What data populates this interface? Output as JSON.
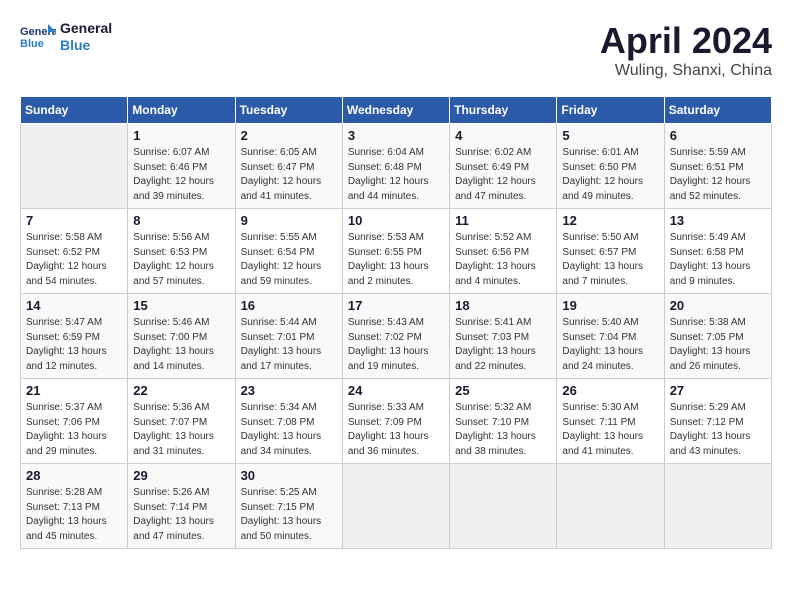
{
  "logo": {
    "line1": "General",
    "line2": "Blue"
  },
  "title": "April 2024",
  "location": "Wuling, Shanxi, China",
  "weekdays": [
    "Sunday",
    "Monday",
    "Tuesday",
    "Wednesday",
    "Thursday",
    "Friday",
    "Saturday"
  ],
  "weeks": [
    [
      {
        "day": "",
        "info": ""
      },
      {
        "day": "1",
        "info": "Sunrise: 6:07 AM\nSunset: 6:46 PM\nDaylight: 12 hours\nand 39 minutes."
      },
      {
        "day": "2",
        "info": "Sunrise: 6:05 AM\nSunset: 6:47 PM\nDaylight: 12 hours\nand 41 minutes."
      },
      {
        "day": "3",
        "info": "Sunrise: 6:04 AM\nSunset: 6:48 PM\nDaylight: 12 hours\nand 44 minutes."
      },
      {
        "day": "4",
        "info": "Sunrise: 6:02 AM\nSunset: 6:49 PM\nDaylight: 12 hours\nand 47 minutes."
      },
      {
        "day": "5",
        "info": "Sunrise: 6:01 AM\nSunset: 6:50 PM\nDaylight: 12 hours\nand 49 minutes."
      },
      {
        "day": "6",
        "info": "Sunrise: 5:59 AM\nSunset: 6:51 PM\nDaylight: 12 hours\nand 52 minutes."
      }
    ],
    [
      {
        "day": "7",
        "info": "Sunrise: 5:58 AM\nSunset: 6:52 PM\nDaylight: 12 hours\nand 54 minutes."
      },
      {
        "day": "8",
        "info": "Sunrise: 5:56 AM\nSunset: 6:53 PM\nDaylight: 12 hours\nand 57 minutes."
      },
      {
        "day": "9",
        "info": "Sunrise: 5:55 AM\nSunset: 6:54 PM\nDaylight: 12 hours\nand 59 minutes."
      },
      {
        "day": "10",
        "info": "Sunrise: 5:53 AM\nSunset: 6:55 PM\nDaylight: 13 hours\nand 2 minutes."
      },
      {
        "day": "11",
        "info": "Sunrise: 5:52 AM\nSunset: 6:56 PM\nDaylight: 13 hours\nand 4 minutes."
      },
      {
        "day": "12",
        "info": "Sunrise: 5:50 AM\nSunset: 6:57 PM\nDaylight: 13 hours\nand 7 minutes."
      },
      {
        "day": "13",
        "info": "Sunrise: 5:49 AM\nSunset: 6:58 PM\nDaylight: 13 hours\nand 9 minutes."
      }
    ],
    [
      {
        "day": "14",
        "info": "Sunrise: 5:47 AM\nSunset: 6:59 PM\nDaylight: 13 hours\nand 12 minutes."
      },
      {
        "day": "15",
        "info": "Sunrise: 5:46 AM\nSunset: 7:00 PM\nDaylight: 13 hours\nand 14 minutes."
      },
      {
        "day": "16",
        "info": "Sunrise: 5:44 AM\nSunset: 7:01 PM\nDaylight: 13 hours\nand 17 minutes."
      },
      {
        "day": "17",
        "info": "Sunrise: 5:43 AM\nSunset: 7:02 PM\nDaylight: 13 hours\nand 19 minutes."
      },
      {
        "day": "18",
        "info": "Sunrise: 5:41 AM\nSunset: 7:03 PM\nDaylight: 13 hours\nand 22 minutes."
      },
      {
        "day": "19",
        "info": "Sunrise: 5:40 AM\nSunset: 7:04 PM\nDaylight: 13 hours\nand 24 minutes."
      },
      {
        "day": "20",
        "info": "Sunrise: 5:38 AM\nSunset: 7:05 PM\nDaylight: 13 hours\nand 26 minutes."
      }
    ],
    [
      {
        "day": "21",
        "info": "Sunrise: 5:37 AM\nSunset: 7:06 PM\nDaylight: 13 hours\nand 29 minutes."
      },
      {
        "day": "22",
        "info": "Sunrise: 5:36 AM\nSunset: 7:07 PM\nDaylight: 13 hours\nand 31 minutes."
      },
      {
        "day": "23",
        "info": "Sunrise: 5:34 AM\nSunset: 7:08 PM\nDaylight: 13 hours\nand 34 minutes."
      },
      {
        "day": "24",
        "info": "Sunrise: 5:33 AM\nSunset: 7:09 PM\nDaylight: 13 hours\nand 36 minutes."
      },
      {
        "day": "25",
        "info": "Sunrise: 5:32 AM\nSunset: 7:10 PM\nDaylight: 13 hours\nand 38 minutes."
      },
      {
        "day": "26",
        "info": "Sunrise: 5:30 AM\nSunset: 7:11 PM\nDaylight: 13 hours\nand 41 minutes."
      },
      {
        "day": "27",
        "info": "Sunrise: 5:29 AM\nSunset: 7:12 PM\nDaylight: 13 hours\nand 43 minutes."
      }
    ],
    [
      {
        "day": "28",
        "info": "Sunrise: 5:28 AM\nSunset: 7:13 PM\nDaylight: 13 hours\nand 45 minutes."
      },
      {
        "day": "29",
        "info": "Sunrise: 5:26 AM\nSunset: 7:14 PM\nDaylight: 13 hours\nand 47 minutes."
      },
      {
        "day": "30",
        "info": "Sunrise: 5:25 AM\nSunset: 7:15 PM\nDaylight: 13 hours\nand 50 minutes."
      },
      {
        "day": "",
        "info": ""
      },
      {
        "day": "",
        "info": ""
      },
      {
        "day": "",
        "info": ""
      },
      {
        "day": "",
        "info": ""
      }
    ]
  ]
}
